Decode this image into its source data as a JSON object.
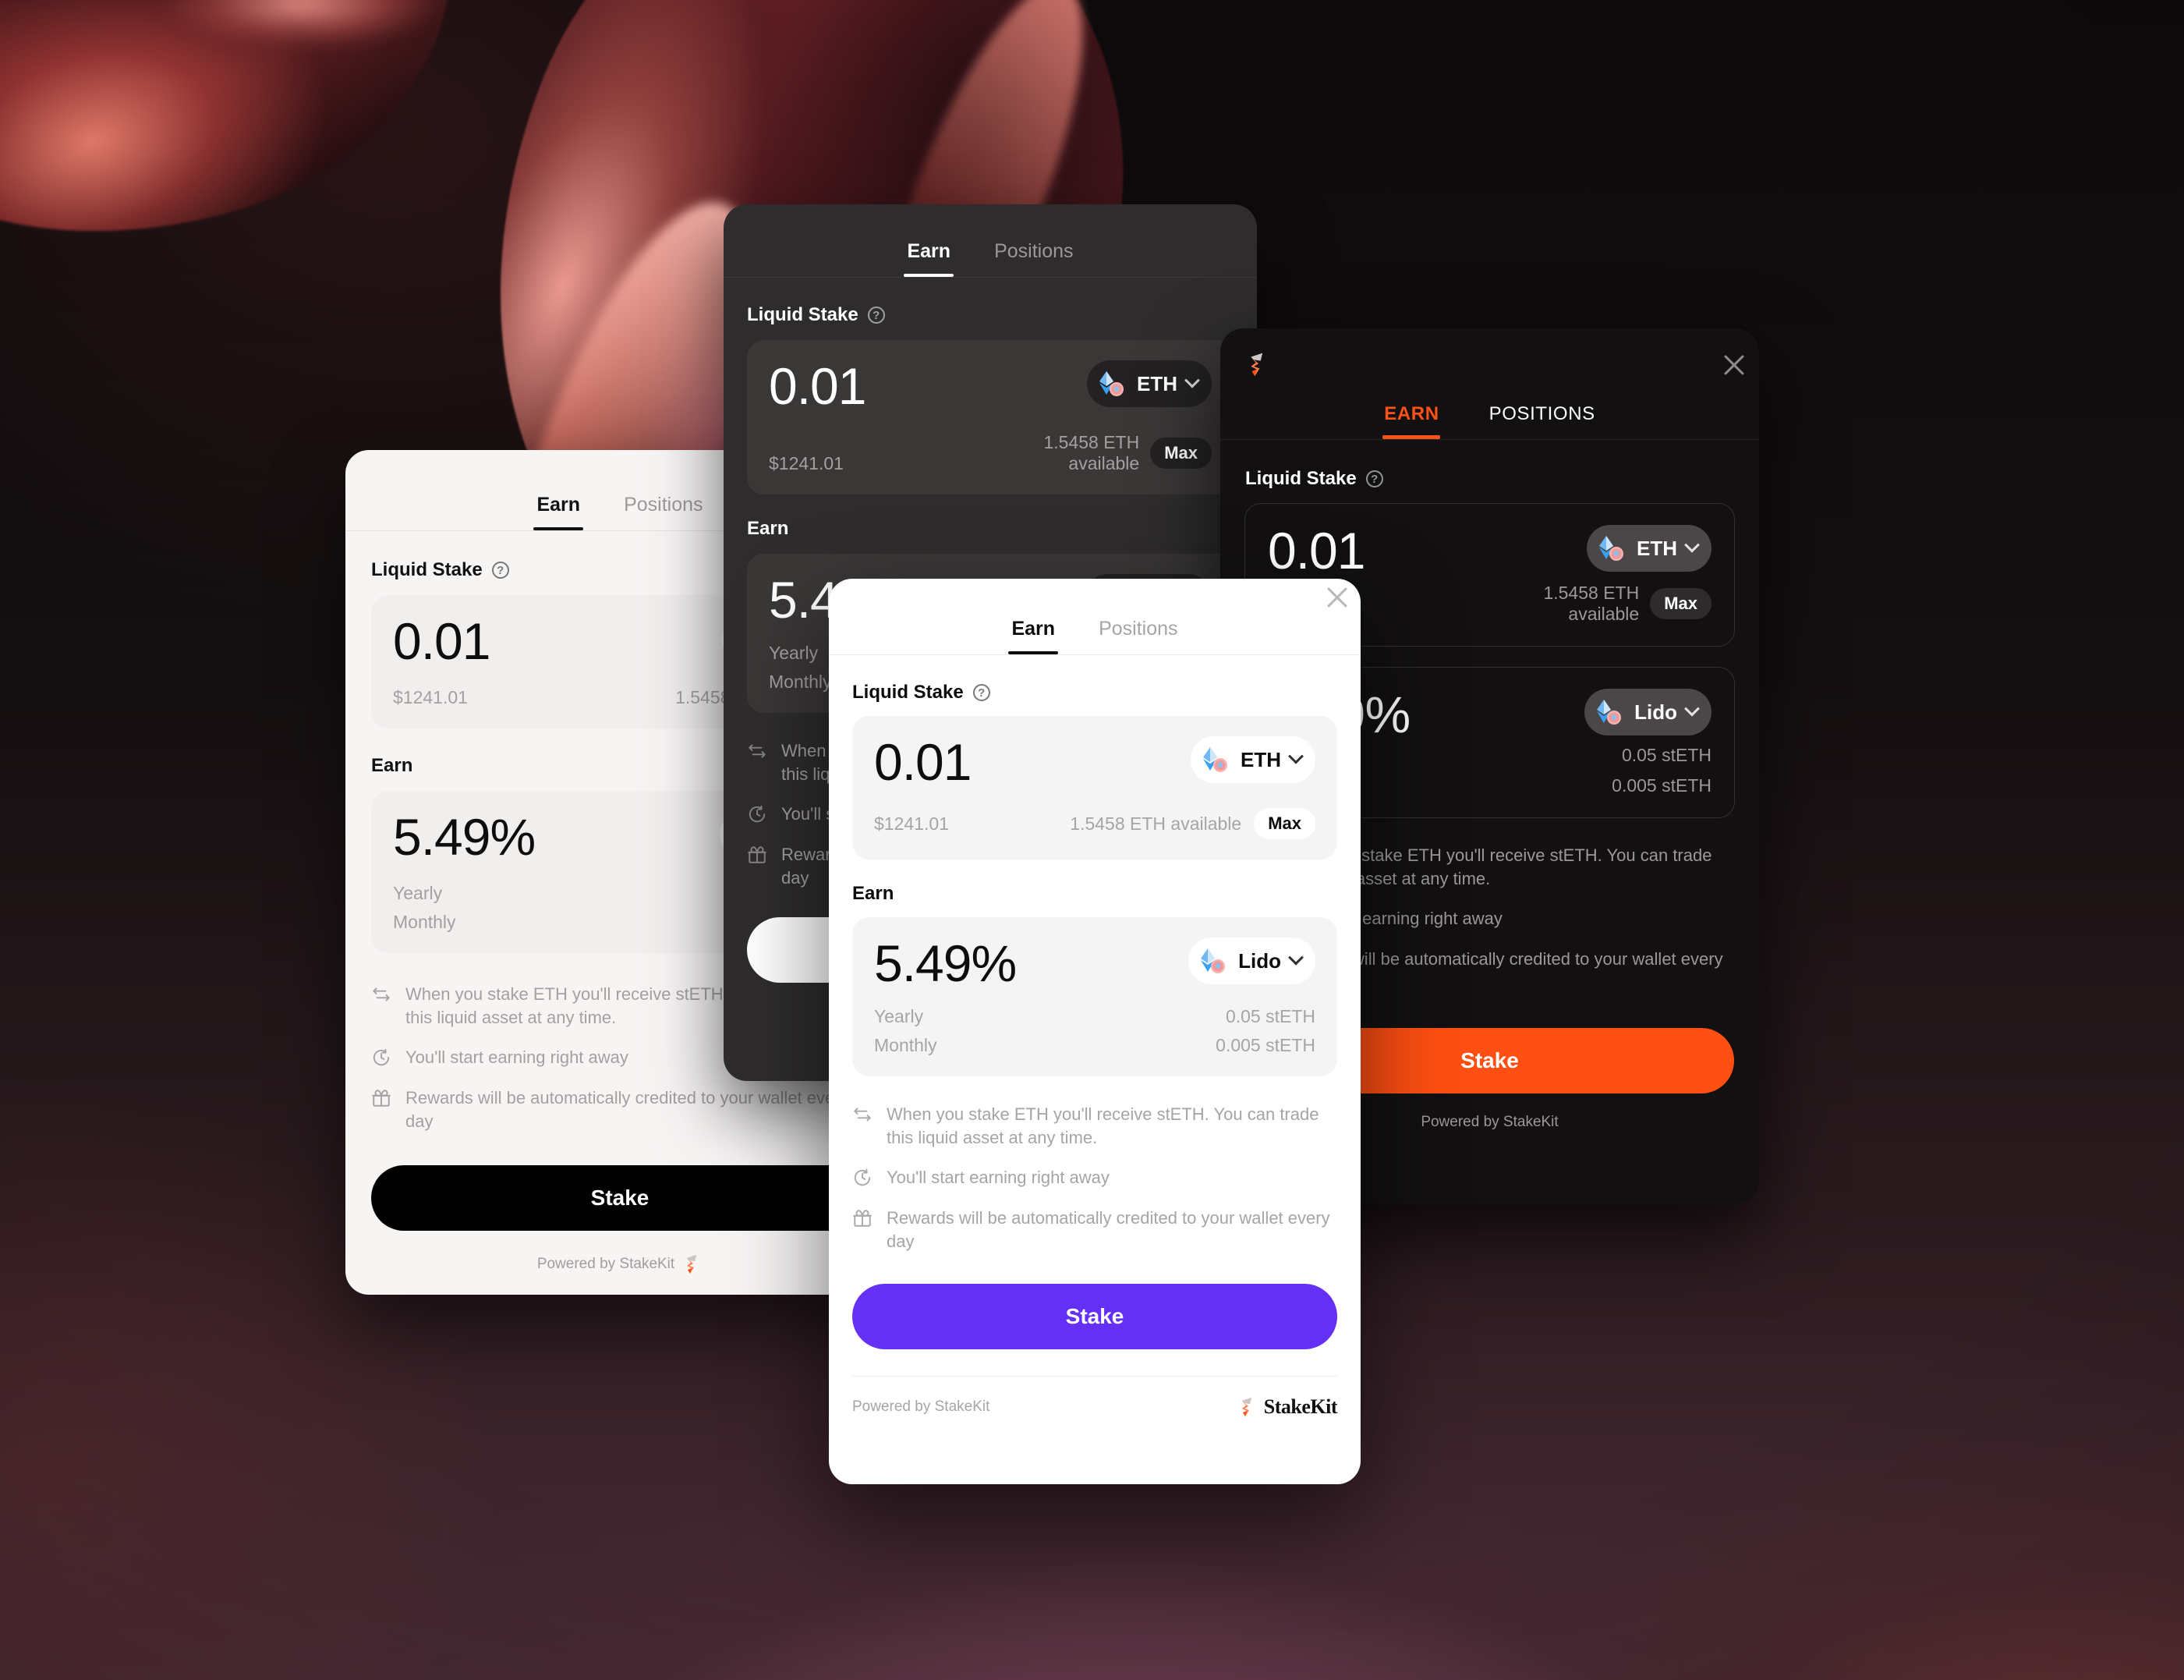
{
  "theme": {
    "light_card_bg": "#f7f5f4",
    "dark_card_bg": "#2e2c2c",
    "black_card_bg": "#121011",
    "white_card_bg": "#ffffff",
    "accent_orange": "#ff5216",
    "accent_purple": "#6430f5",
    "accent_black": "#000000",
    "token_blue": "#3aa0f0",
    "token_pink": "#f5a3a3"
  },
  "common": {
    "tabs": [
      {
        "label": "Earn",
        "active": true
      },
      {
        "label": "Positions",
        "active": false
      }
    ],
    "tabs_upper": [
      {
        "label": "EARN",
        "active": true
      },
      {
        "label": "POSITIONS",
        "active": false
      }
    ],
    "liquid_stake_label": "Liquid Stake",
    "help_glyph": "?",
    "amount": "0.01",
    "amount_fiat": "$1241.01",
    "available": "1.5458 ETH available",
    "available_line1": "1.5458 ETH",
    "available_line2": "available",
    "max_label": "Max",
    "token_symbol": "ETH",
    "earn_label": "Earn",
    "apy": "5.49%",
    "apy_partial": "5.4",
    "apy_partial_right": "9%",
    "provider": "Lido",
    "yearly_label": "Yearly",
    "yearly_value": "0.05 stETH",
    "monthly_label": "Monthly",
    "monthly_value": "0.005 stETH",
    "bullets": [
      {
        "icon": "swap-icon",
        "text": "When you stake ETH you'll receive stETH. You can trade this liquid asset at any time."
      },
      {
        "icon": "clock-icon",
        "text": "You'll start earning right away"
      },
      {
        "icon": "gift-icon",
        "text": "Rewards will be automatically credited to your wallet every day"
      }
    ],
    "stake_button": "Stake",
    "powered_by": "Powered by StakeKit",
    "powered_by_prefix": "Powered by ",
    "brand_name": "StakeKit"
  },
  "card_light": {
    "id": "light-theme-widget",
    "stake_button": "Stake",
    "powered_by": "Powered by StakeKit"
  },
  "card_dark": {
    "id": "dark-grey-theme-widget",
    "stake_button": "Stake",
    "powered_by": "Powered by StakeKit"
  },
  "card_black": {
    "id": "black-orange-theme-widget",
    "stake_button": "Stake",
    "powered_by": "Powered by StakeKit"
  },
  "card_white": {
    "id": "white-purple-theme-widget",
    "stake_button": "Stake",
    "powered_by_prefix": "Powered by StakeKit",
    "brand_name": "StakeKit"
  }
}
